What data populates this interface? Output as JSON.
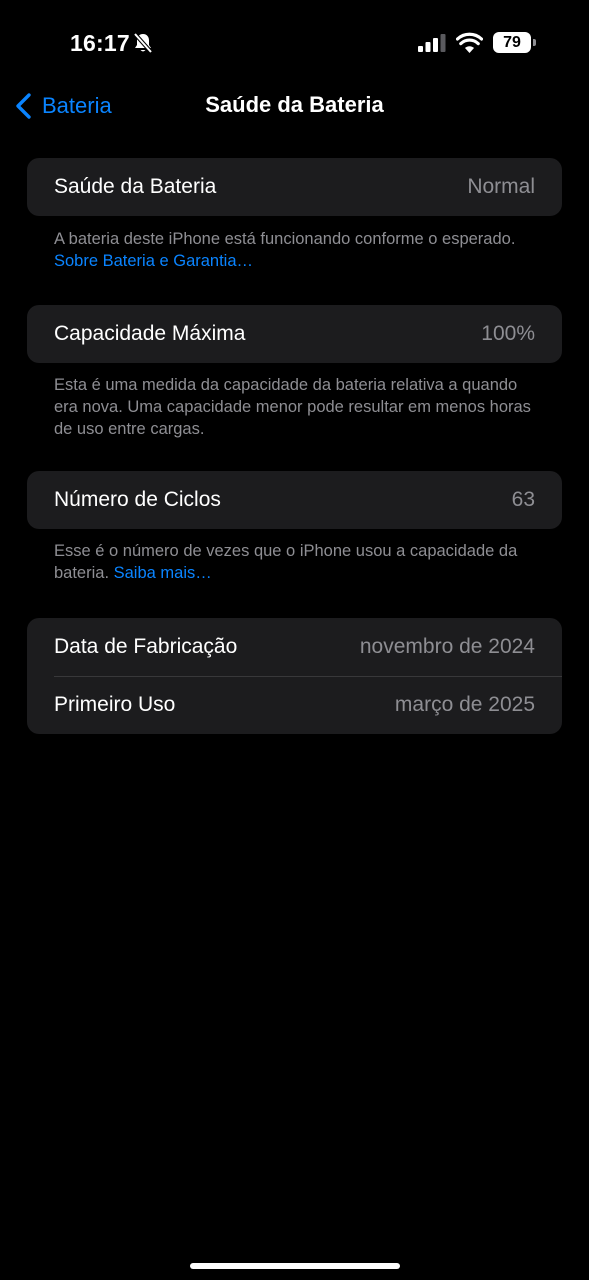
{
  "status_bar": {
    "time": "16:17",
    "battery_level": "79",
    "icons": [
      "bell-slash-icon",
      "cellular-signal-icon",
      "wifi-icon",
      "battery-icon"
    ]
  },
  "nav": {
    "back_label": "Bateria",
    "title": "Saúde da Bateria"
  },
  "health": {
    "label": "Saúde da Bateria",
    "value": "Normal",
    "footer_text": "A bateria deste iPhone está funcionando conforme o esperado. ",
    "footer_link": "Sobre Bateria e Garantia…"
  },
  "capacity": {
    "label": "Capacidade Máxima",
    "value": "100%",
    "footer_text": "Esta é uma medida da capacidade da bateria relativa a quando era nova. Uma capacidade menor pode resultar em menos horas de uso entre cargas."
  },
  "cycles": {
    "label": "Número de Ciclos",
    "value": "63",
    "footer_text": "Esse é o número de vezes que o iPhone usou a capacidade da bateria. ",
    "footer_link": "Saiba mais…"
  },
  "dates": {
    "manufacture_label": "Data de Fabricação",
    "manufacture_value": "novembro de 2024",
    "first_use_label": "Primeiro Uso",
    "first_use_value": "março de 2025"
  },
  "colors": {
    "background": "#000000",
    "group_background": "#1c1c1e",
    "accent": "#0a84ff",
    "secondary_text": "#8e8e93"
  }
}
